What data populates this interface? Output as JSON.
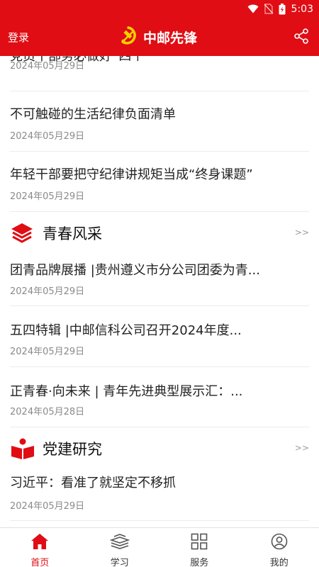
{
  "status_bar": {
    "time": "5:03"
  },
  "header": {
    "login_label": "登录",
    "title": "中邮先锋"
  },
  "articles_top": [
    {
      "title": "党员干部务必做好“四个一”",
      "date": "2024年05月29日"
    },
    {
      "title": "不可触碰的生活纪律负面清单",
      "date": "2024年05月29日"
    },
    {
      "title": "年轻干部要把守纪律讲规矩当成“终身课题”",
      "date": "2024年05月29日"
    }
  ],
  "section_youth": {
    "title": "青春风采",
    "more": ">>",
    "items": [
      {
        "title": "团青品牌展播 |贵州遵义市分公司团委为青...",
        "date": "2024年05月29日"
      },
      {
        "title": "五四特辑 |中邮信科公司召开2024年度...",
        "date": "2024年05月29日"
      },
      {
        "title": "正青春·向未来 | 青年先进典型展示汇：...",
        "date": "2024年05月28日"
      }
    ]
  },
  "section_research": {
    "title": "党建研究",
    "more": ">>",
    "items": [
      {
        "title": "习近平：看准了就坚定不移抓",
        "date": "2024年05月29日"
      }
    ]
  },
  "tabbar": {
    "tabs": [
      {
        "label": "首页",
        "icon": "home-icon",
        "active": true
      },
      {
        "label": "学习",
        "icon": "books-icon",
        "active": false
      },
      {
        "label": "服务",
        "icon": "grid-icon",
        "active": false
      },
      {
        "label": "我的",
        "icon": "user-icon",
        "active": false
      }
    ]
  },
  "colors": {
    "brand_red": "#e00d14",
    "date_gray": "#8a8a8a",
    "divider": "#ececec"
  }
}
